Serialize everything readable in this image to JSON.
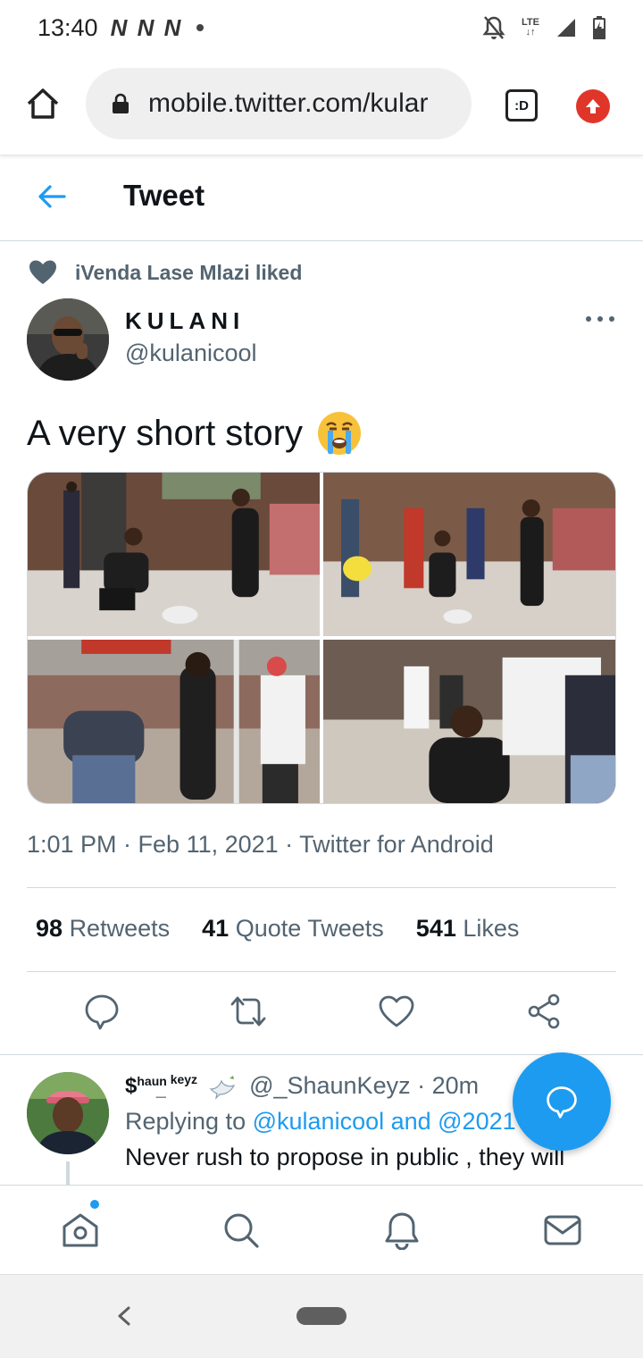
{
  "status_bar": {
    "time": "13:40",
    "indicators": "N N N",
    "network": "LTE",
    "icons": [
      "mute-bell-icon",
      "lte-icon",
      "signal-icon",
      "battery-icon"
    ]
  },
  "browser": {
    "url": "mobile.twitter.com/kular",
    "tab_label": ":D"
  },
  "header": {
    "title": "Tweet"
  },
  "social_context": {
    "text": "iVenda Lase Mlazi liked"
  },
  "tweet": {
    "author_name": "KULANI",
    "author_handle": "@kulanicool",
    "text": "A very short story",
    "emoji": "crying-face-emoji",
    "timestamp": "1:01 PM · Feb 11, 2021 · Twitter for Android",
    "photos": [
      "photo-1",
      "photo-2",
      "photo-3",
      "photo-4"
    ]
  },
  "stats": {
    "retweets_count": "98",
    "retweets_label": "Retweets",
    "quotes_count": "41",
    "quotes_label": "Quote Tweets",
    "likes_count": "541",
    "likes_label": "Likes"
  },
  "reply": {
    "name_symbol": "$",
    "name_small_1": "haun",
    "name_small_2": "keyz",
    "name_under": "_",
    "handle": "@_ShaunKeyz",
    "time": "· 20m",
    "replying_prefix": "Replying to",
    "replying_mentions": "@kulanicool and @2021",
    "text": "Never rush to propose in public , they will"
  },
  "colors": {
    "accent": "#1d9bf0",
    "muted": "#536471",
    "update": "#e0362a"
  }
}
